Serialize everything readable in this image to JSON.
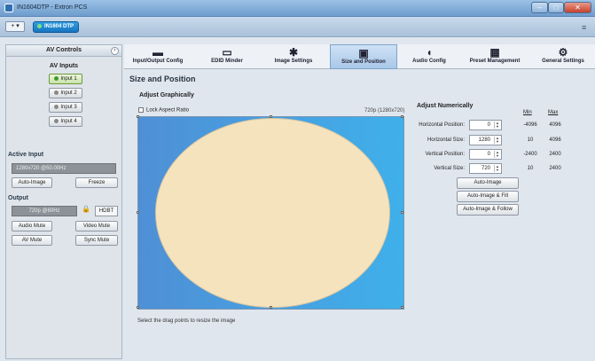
{
  "window": {
    "title": "IN1604DTP - Extron PCS",
    "min": "–",
    "max": "□",
    "close": "✕"
  },
  "toolbar": {
    "add_label": "+ ▾",
    "device_tab": "IN1604 DTP",
    "menu_icon": "≡"
  },
  "left_panel": {
    "header": "AV Controls",
    "collapse": "‹",
    "inputs_title": "AV Inputs",
    "inputs": [
      {
        "label": "Input 1",
        "active": true
      },
      {
        "label": "Input 2",
        "active": false
      },
      {
        "label": "Input 3",
        "active": false
      },
      {
        "label": "Input 4",
        "active": false
      }
    ],
    "active_input_title": "Active Input",
    "active_input_value": "1280x720 @50.00Hz",
    "auto_image": "Auto-Image",
    "freeze": "Freeze",
    "output_title": "Output",
    "output_value": "720p @60Hz",
    "hdbt": "HDBT",
    "audio_mute": "Audio Mute",
    "video_mute": "Video Mute",
    "av_mute": "AV Mute",
    "sync_mute": "Sync Mute"
  },
  "tabs": [
    {
      "label": "Input/Output Config",
      "icon": "io-config-icon",
      "glyph": "▬"
    },
    {
      "label": "EDID Minder",
      "icon": "monitor-icon",
      "glyph": "▭"
    },
    {
      "label": "Image Settings",
      "icon": "image-settings-icon",
      "glyph": "✱"
    },
    {
      "label": "Size and Position",
      "icon": "size-position-icon",
      "glyph": "▣",
      "selected": true
    },
    {
      "label": "Audio Config",
      "icon": "speaker-icon",
      "glyph": "◖"
    },
    {
      "label": "Preset Management",
      "icon": "preset-icon",
      "glyph": "▦"
    },
    {
      "label": "General Settings",
      "icon": "gear-icon",
      "glyph": "⚙"
    }
  ],
  "main": {
    "title": "Size and Position",
    "adjust_graphically": "Adjust Graphically",
    "lock_aspect_ratio": "Lock Aspect Ratio",
    "resolution": "720p (1280x720)",
    "hint": "Select the drag points to resize the image",
    "adjust_numerically": "Adjust Numerically",
    "min_header": "Min",
    "max_header": "Max",
    "rows": [
      {
        "label": "Horizontal Position:",
        "value": "0",
        "min": "-4096",
        "max": "4096"
      },
      {
        "label": "Horizontal Size:",
        "value": "1280",
        "min": "10",
        "max": "4096"
      },
      {
        "label": "Vertical Position:",
        "value": "0",
        "min": "-2400",
        "max": "2400"
      },
      {
        "label": "Vertical Size:",
        "value": "720",
        "min": "10",
        "max": "2400"
      }
    ],
    "auto_image": "Auto-Image",
    "auto_image_fill": "Auto-Image & Fill",
    "auto_image_follow": "Auto-Image & Follow"
  }
}
